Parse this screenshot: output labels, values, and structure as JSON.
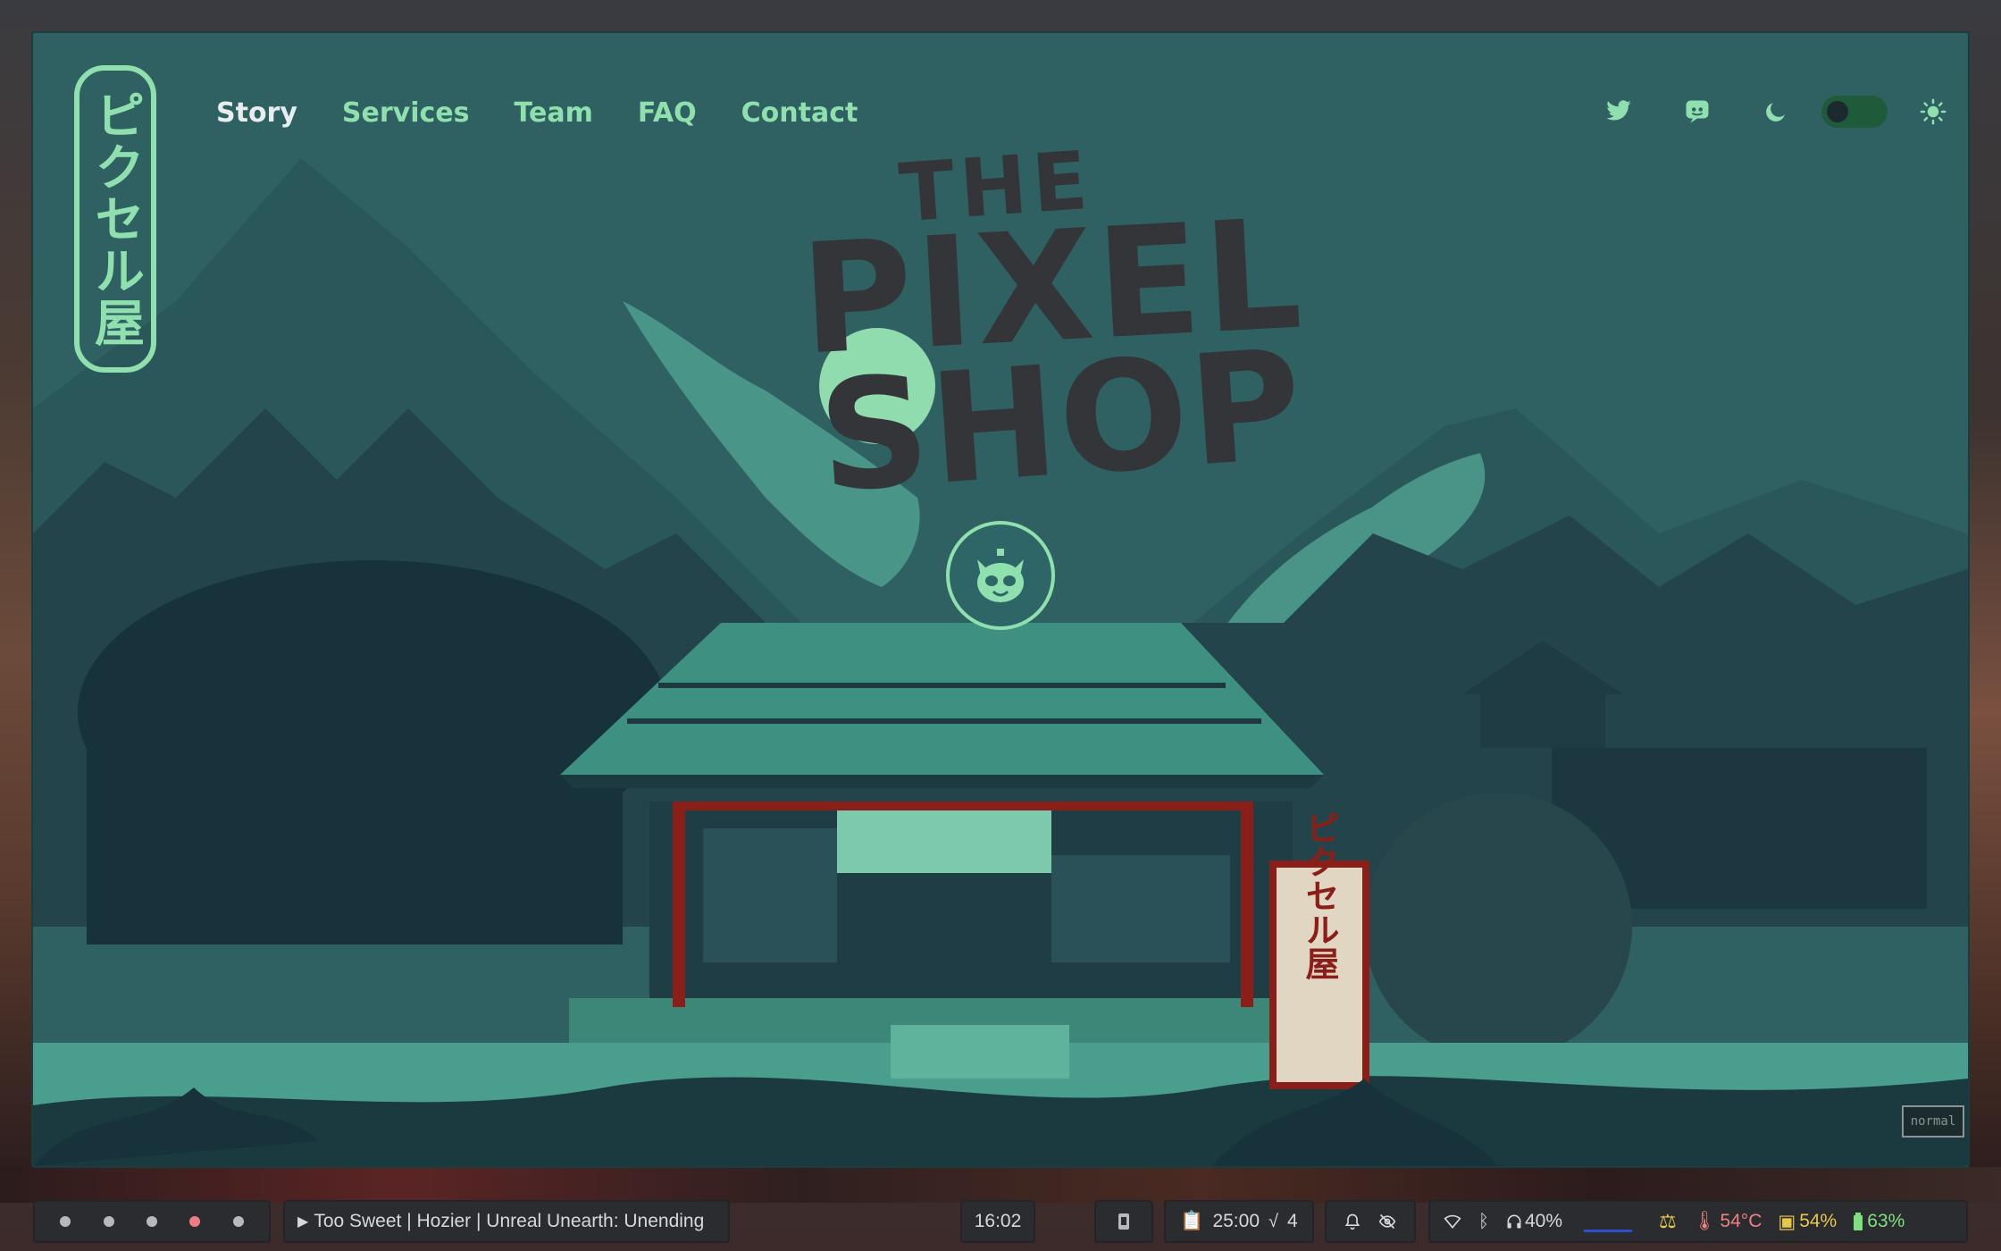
{
  "window": {
    "logo": {
      "text": "ピクセル屋",
      "color": "#8fe0ae"
    },
    "nav": {
      "links": [
        "Story",
        "Services",
        "Team",
        "FAQ",
        "Contact"
      ],
      "active": "Story",
      "icons": [
        "twitter-icon",
        "discord-icon",
        "moon-icon",
        "theme-toggle",
        "sun-icon"
      ]
    },
    "hero": {
      "title_line1": "THE",
      "title_line2": "PIXEL",
      "title_line3": "SHOP",
      "shop_sign": "ピクセル屋",
      "mascot": "raccoon-icon"
    },
    "mode_indicator": "normal",
    "colors": {
      "accent": "#8fe0ae",
      "background": "#2f6162",
      "title": "#333538",
      "sign_red": "#8a1f1a"
    }
  },
  "taskbar": {
    "workspaces": [
      "1",
      "2",
      "3",
      "4",
      "5"
    ],
    "active_workspace_index": 3,
    "media": "Too Sweet | Hozier | Unreal Unearth: Unending",
    "clock": "16:02",
    "timer": "25:00",
    "tasks": "4",
    "audio": "40%",
    "temperature": "54°C",
    "cpu": "54%",
    "battery": "63%"
  }
}
